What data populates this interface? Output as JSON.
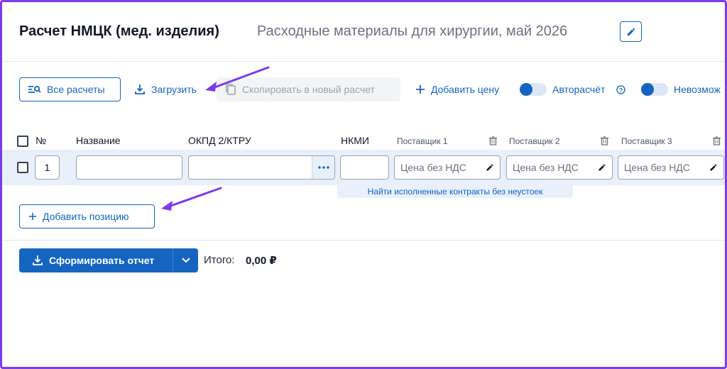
{
  "header": {
    "title": "Расчет НМЦК (мед. изделия)",
    "subtitle": "Расходные материалы для хирургии, май 2026"
  },
  "toolbar": {
    "all_calcs": "Все расчеты",
    "upload": "Загрузить",
    "copy_new": "Скопировать в новый расчет",
    "add_price": "Добавить цену",
    "autocalc": "Авторасчёт",
    "impossible": "Невозмож"
  },
  "table": {
    "col_num": "№",
    "col_name": "Название",
    "col_okpd": "ОКПД 2/КТРУ",
    "col_nkmi": "НКМИ",
    "suppliers": [
      "Поставщик 1",
      "Поставщик 2",
      "Поставщик 3"
    ],
    "row": {
      "number": "1",
      "name": "",
      "okpd": "",
      "nkmi": "",
      "price_placeholder": "Цена без НДС"
    },
    "find_contracts": "Найти исполненные контракты без неустоек"
  },
  "add_position": "Добавить позицию",
  "footer": {
    "report_button": "Сформировать отчет",
    "total_label": "Итого:",
    "total_value": "0,00 ₽"
  },
  "colors": {
    "primary": "#1565c0",
    "row_bg": "#e8f0fb",
    "annotation": "#7c3aed"
  }
}
